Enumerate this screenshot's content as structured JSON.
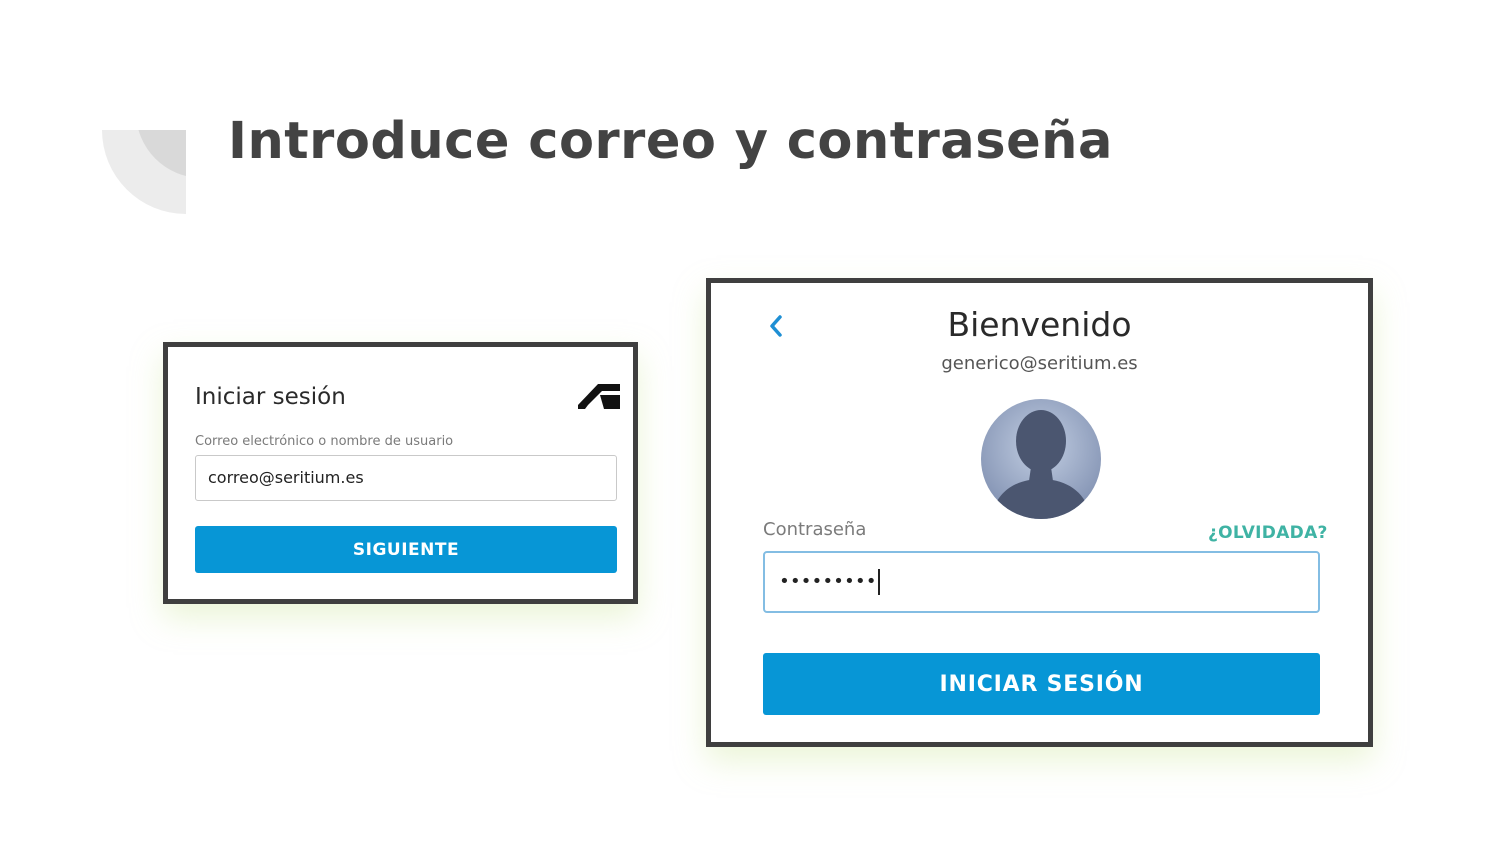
{
  "slide": {
    "title": "Introduce correo y contraseña"
  },
  "login_step1": {
    "heading": "Iniciar sesión",
    "logo_icon": "autodesk-logo-icon",
    "field_label": "Correo electrónico o nombre de usuario",
    "email_value": "correo@seritium.es",
    "next_button": "SIGUIENTE"
  },
  "login_step2": {
    "back_icon": "chevron-left-icon",
    "heading": "Bienvenido",
    "email": "generico@seritium.es",
    "avatar_icon": "user-avatar-icon",
    "password_label": "Contraseña",
    "forgot_link": "¿OLVIDADA?",
    "password_value": "•••••••••",
    "submit_button": "INICIAR SESIÓN"
  },
  "colors": {
    "primary_button": "#0796d6",
    "link_accent": "#3fb3a4",
    "panel_border": "#3f3f3f",
    "title_text": "#434343"
  }
}
